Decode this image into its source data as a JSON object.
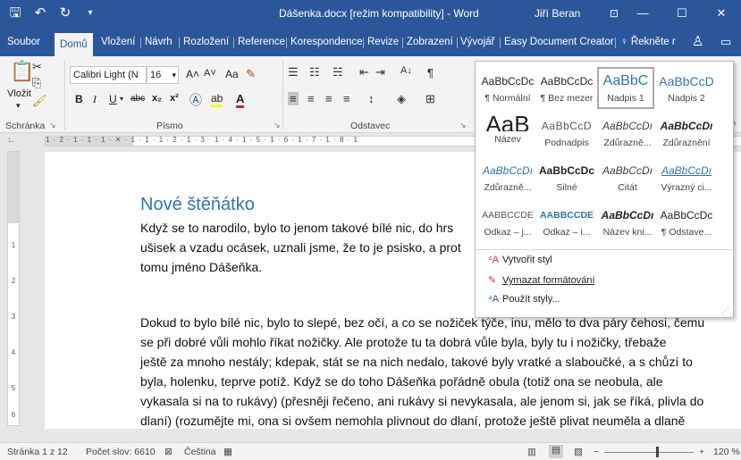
{
  "titlebar": {
    "save_icon": "save-icon",
    "undo_icon": "undo-icon",
    "redo_icon": "redo-icon",
    "qat_more_icon": "customize-qat-icon",
    "title": "Dášenka.docx [režim kompatibility] - Word",
    "user": "Jiří Beran",
    "ribbon_display_icon": "ribbon-display-options-icon",
    "minimize": "—",
    "maximize": "☐",
    "close": "✕",
    "colors": {
      "bar": "#2b579a"
    }
  },
  "tabs": [
    "Soubor",
    "Domů",
    "Vložení",
    "Návrh",
    "Rozložení",
    "Reference",
    "Korespondence",
    "Revize",
    "Zobrazení",
    "Vývojář",
    "Easy Document Creator"
  ],
  "tellme": "Řekněte r",
  "ribbon": {
    "paste_label": "Vložit",
    "clipboard_group": "Schránka",
    "font_name": "Calibri Light (N",
    "font_size": "16",
    "font_group": "Písmo",
    "paragraph_group": "Odstavec",
    "bold": "B",
    "italic": "I",
    "underline": "U",
    "strike": "abc",
    "subscript": "x₂",
    "superscript": "x²",
    "grow_font": "A˄",
    "shrink_font": "A˅",
    "change_case": "Aa",
    "pilcrow": "¶"
  },
  "gallery": {
    "styles": [
      {
        "sample": "AaBbCcDc",
        "name": "¶ Normální"
      },
      {
        "sample": "AaBbCcDc",
        "name": "¶ Bez mezer"
      },
      {
        "sample": "AaBbC",
        "name": "Nadpis 1"
      },
      {
        "sample": "AaBbCcD",
        "name": "Nadpis 2"
      },
      {
        "sample": "AaB",
        "name": "Název"
      },
      {
        "sample": "AaBbCcD",
        "name": "Podnadpis"
      },
      {
        "sample": "AaBbCcDı",
        "name": "Zdůrazně..."
      },
      {
        "sample": "AaBbCcDı",
        "name": "Zdůraznění"
      },
      {
        "sample": "AaBbCcDı",
        "name": "Zdůrazně..."
      },
      {
        "sample": "AaBbCcDc",
        "name": "Silné"
      },
      {
        "sample": "AaBbCcDı",
        "name": "Citát"
      },
      {
        "sample": "AaBbCcDı",
        "name": "Výrazný ci..."
      },
      {
        "sample": "AABBCCDE",
        "name": "Odkaz – j..."
      },
      {
        "sample": "AABBCCDE",
        "name": "Odkaz – i..."
      },
      {
        "sample": "AaBbCcDı",
        "name": "Název kni..."
      },
      {
        "sample": "AaBbCcDc",
        "name": "¶ Odstave..."
      }
    ],
    "commands": [
      {
        "icon": "create-style-icon",
        "label": "Vytvořit styl"
      },
      {
        "icon": "clear-formatting-icon",
        "label": "Vymazat formátování"
      },
      {
        "icon": "apply-styles-icon",
        "label": "Použít styly..."
      }
    ]
  },
  "document": {
    "heading": "Nové štěňátko",
    "para1": [
      "Když se to narodilo, bylo to jenom takové bílé nic, do hrs",
      "ušisek a vzadu ocásek, uznali jsme, že to je psisko, a prot",
      "tomu jméno Dášeňka."
    ],
    "para2": [
      "Dokud to bylo bílé nic, bylo to slepé, bez očí, a co se nožiček týče, inu, mělo to dva páry čehosi, čemu",
      "se při dobré vůli mohlo říkat nožičky. Ale protože tu ta dobrá vůle byla, byly tu i nožičky, třebaže",
      "ještě za mnoho nestály; kdepak, stát se na nich nedalo, takové byly vratké a slaboučké, a s chůzí to",
      "byla, holenku, teprve potíž. Když se do toho Dášeňka pořádně obula (totiž ona se neobula, ale",
      "vykasala si na to rukávy) (přesněji řečeno, ani rukávy si nevykasala, ale jenom si, jak se říká, plivla do",
      "dlaní) (rozumějte mi, ona si ovšem nemohla plivnout do dlaní, protože ještě plivat neuměla a dlaně"
    ]
  },
  "ruler_ticks": "1 · 2 · 1 · 1 · 1 · ✕ · 1 · 1 · 1 · 2 · 1 · 3 · 1 · 4 · 1 · 5 · 1 · 6 · 1 · 7 · 1 · 8 · 1",
  "status": {
    "page": "Stránka 1 z 12",
    "words": "Počet slov: 6610",
    "language": "Čeština",
    "zoom": "120 %",
    "zoom_minus": "−",
    "zoom_plus": "+"
  }
}
